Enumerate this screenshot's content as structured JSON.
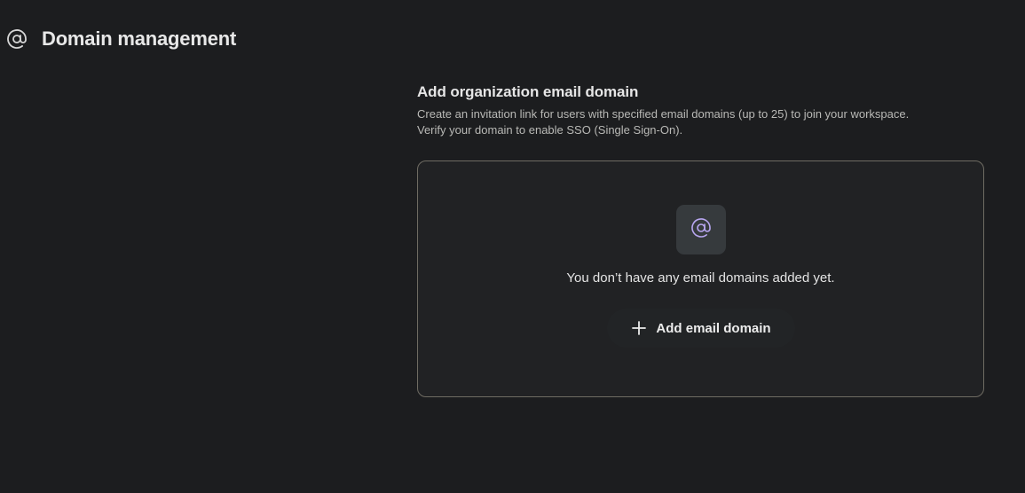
{
  "header": {
    "icon": "at-sign-icon",
    "title": "Domain management"
  },
  "section": {
    "title": "Add organization email domain",
    "description_line1": "Create an invitation link for users with specified email domains (up to 25) to join your workspace.",
    "description_line2": "Verify your domain to enable SSO (Single Sign-On)."
  },
  "empty_state": {
    "icon": "at-sign-icon",
    "message": "You don’t have any email domains added yet.",
    "button_icon": "plus-icon",
    "button_label": "Add email domain"
  },
  "colors": {
    "background": "#1c1d1f",
    "card_background": "#212224",
    "card_border": "#6f6c63",
    "icon_box": "#363a3d",
    "accent_icon": "#b9a7f2"
  }
}
